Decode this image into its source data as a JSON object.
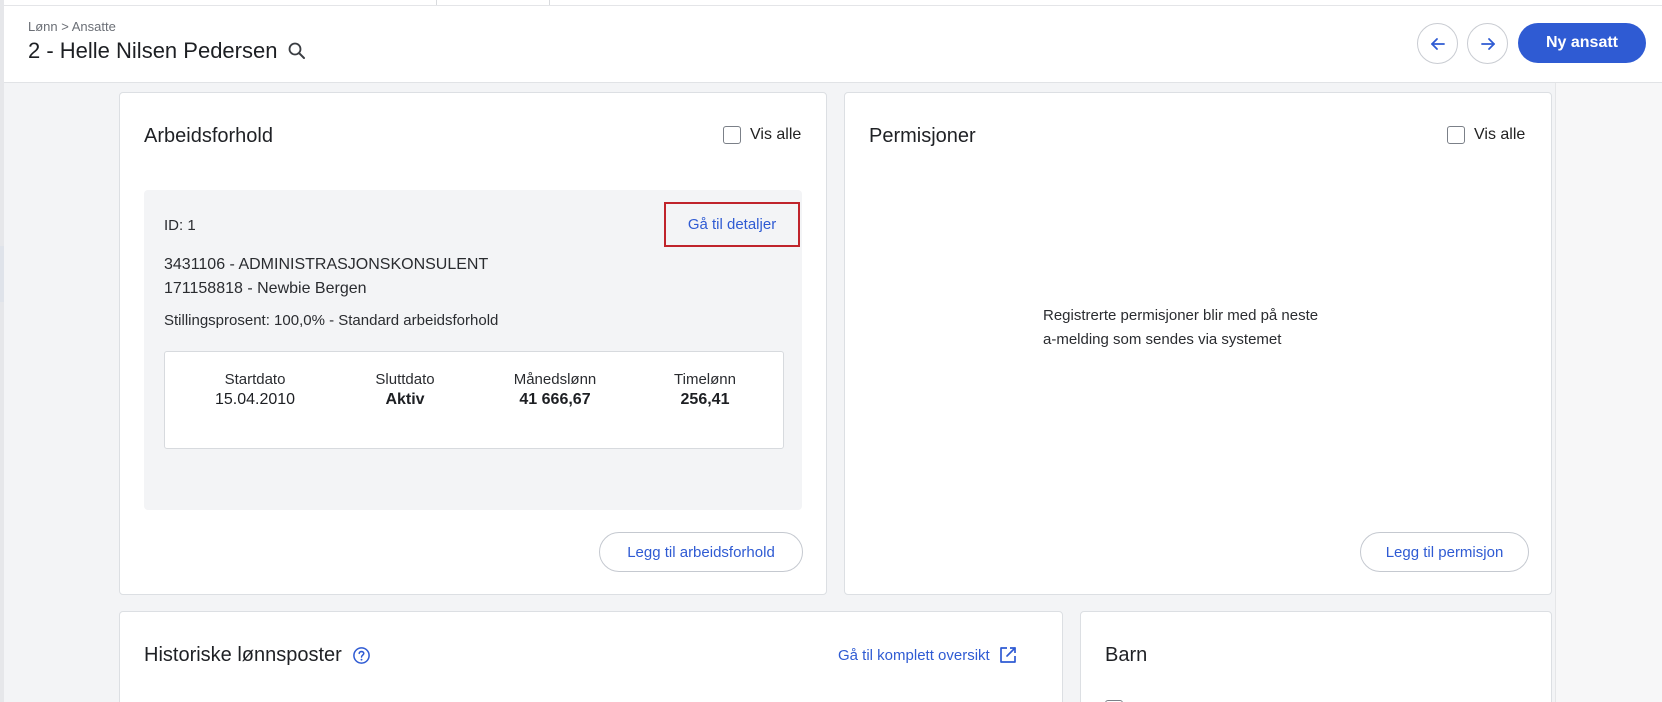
{
  "header": {
    "breadcrumb": "Lønn > Ansatte",
    "title": "2 - Helle Nilsen Pedersen",
    "new_employee_label": "Ny ansatt",
    "accent_color": "#2f5bd3"
  },
  "employment": {
    "title": "Arbeidsforhold",
    "show_all_label": "Vis alle",
    "id_text": "ID: 1",
    "details_link": "Gå til detaljer",
    "position_line": "3431106 - ADMINISTRASJONSKONSULENT",
    "org_line": "171158818 - Newbie Bergen",
    "percent_line": "Stillingsprosent: 100,0% - Standard arbeidsforhold",
    "stats": [
      {
        "label": "Startdato",
        "value": "15.04.2010"
      },
      {
        "label": "Sluttdato",
        "value": "Aktiv"
      },
      {
        "label": "Månedslønn",
        "value": "41 666,67"
      },
      {
        "label": "Timelønn",
        "value": "256,41"
      }
    ],
    "add_button": "Legg til arbeidsforhold"
  },
  "leave": {
    "title": "Permisjoner",
    "show_all_label": "Vis alle",
    "info_text": "Registrerte permisjoner blir med på neste a-melding som sendes via systemet",
    "add_button": "Legg til permisjon"
  },
  "history": {
    "title": "Historiske lønnsposter",
    "overview_link": "Gå til komplett oversikt"
  },
  "children": {
    "title": "Barn"
  }
}
